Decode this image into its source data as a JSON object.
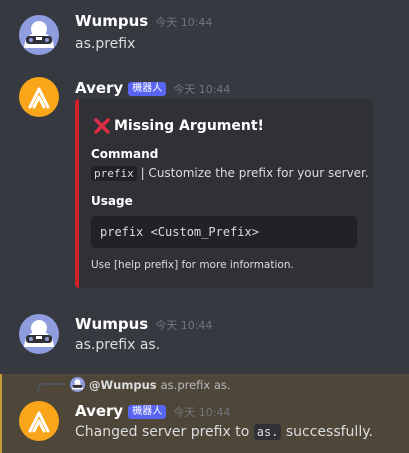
{
  "messages": [
    {
      "username": "Wumpus",
      "timestamp": "今天 10:44",
      "content": "as.prefix"
    },
    {
      "username": "Avery",
      "bot_tag": "機器人",
      "timestamp": "今天 10:44",
      "embed": {
        "title": "Missing Argument!",
        "title_icon": "red-x-icon",
        "accent_color": "#d1202a",
        "command_label": "Command",
        "command_code": "prefix",
        "command_desc": "| Customize the prefix for your server.",
        "usage_label": "Usage",
        "usage_code": "prefix <Custom_Prefix>",
        "footer": "Use [help prefix] for more information."
      }
    },
    {
      "username": "Wumpus",
      "timestamp": "今天 10:44",
      "content": "as.prefix as."
    },
    {
      "username": "Avery",
      "bot_tag": "機器人",
      "timestamp": "今天 10:44",
      "reply": {
        "mention": "@Wumpus",
        "text": "as.prefix as."
      },
      "content_before": "Changed server prefix to",
      "content_code": "as.",
      "content_after": "successfully."
    }
  ],
  "colors": {
    "background": "#36393f",
    "bot_tag": "#5865f2",
    "mention_highlight": "#4d4639",
    "avery_avatar": "#faa61a"
  }
}
